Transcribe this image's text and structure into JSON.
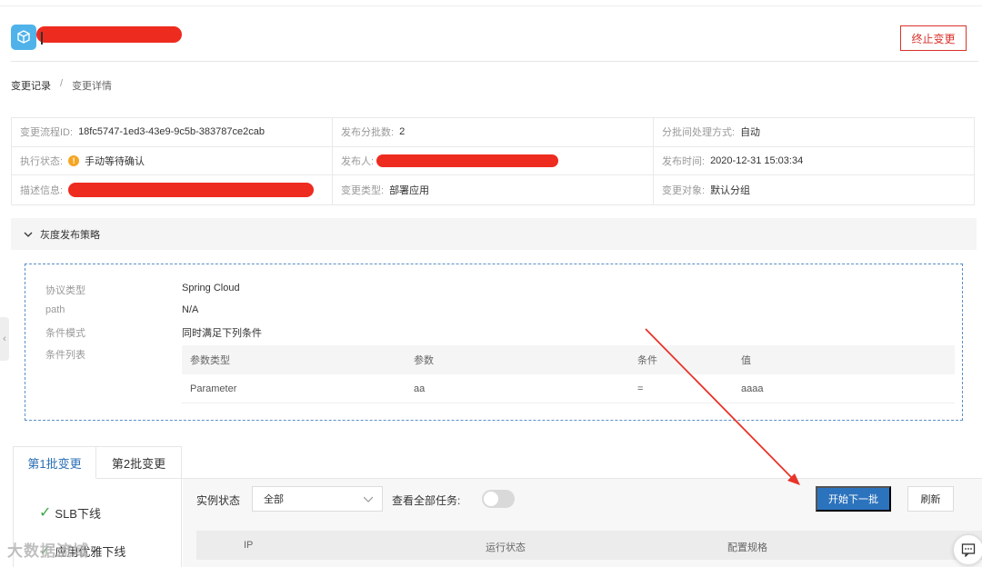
{
  "header": {
    "stop_button": "终止变更"
  },
  "breadcrumb": {
    "root": "变更记录",
    "separator": "/",
    "current": "变更详情"
  },
  "info": {
    "flow_id_label": "变更流程ID:",
    "flow_id_value": "18fc5747-1ed3-43e9-9c5b-383787ce2cab",
    "batch_count_label": "发布分批数:",
    "batch_count_value": "2",
    "batch_mode_label": "分批间处理方式:",
    "batch_mode_value": "自动",
    "exec_status_label": "执行状态:",
    "exec_status_value": "手动等待确认",
    "publisher_label": "发布人:",
    "publish_time_label": "发布时间:",
    "publish_time_value": "2020-12-31 15:03:34",
    "description_label": "描述信息:",
    "change_type_label": "变更类型:",
    "change_type_value": "部署应用",
    "change_target_label": "变更对象:",
    "change_target_value": "默认分组"
  },
  "strategy": {
    "section_title": "灰度发布策略",
    "labels": {
      "protocol": "协议类型",
      "path": "path",
      "mode": "条件模式",
      "list": "条件列表"
    },
    "values": {
      "protocol": "Spring Cloud",
      "path": "N/A",
      "mode": "同时满足下列条件"
    },
    "table": {
      "headers": [
        "参数类型",
        "参数",
        "条件",
        "值"
      ],
      "rows": [
        [
          "Parameter",
          "aa",
          "=",
          "aaaa"
        ]
      ]
    }
  },
  "tabs": [
    "第1批变更",
    "第2批变更"
  ],
  "steps": [
    "SLB下线",
    "应用优雅下线"
  ],
  "panel": {
    "instance_status_label": "实例状态",
    "instance_status_value": "全部",
    "view_all_label": "查看全部任务:",
    "next_batch_button": "开始下一批",
    "refresh_button": "刷新",
    "columns": [
      "IP",
      "运行状态",
      "配置规格"
    ]
  },
  "watermark": "大数据流域",
  "colors": {
    "primary": "#2c73be",
    "danger": "#d9312a",
    "success": "#39a845",
    "warning": "#f5a623",
    "redaction": "#ee2b1f"
  }
}
